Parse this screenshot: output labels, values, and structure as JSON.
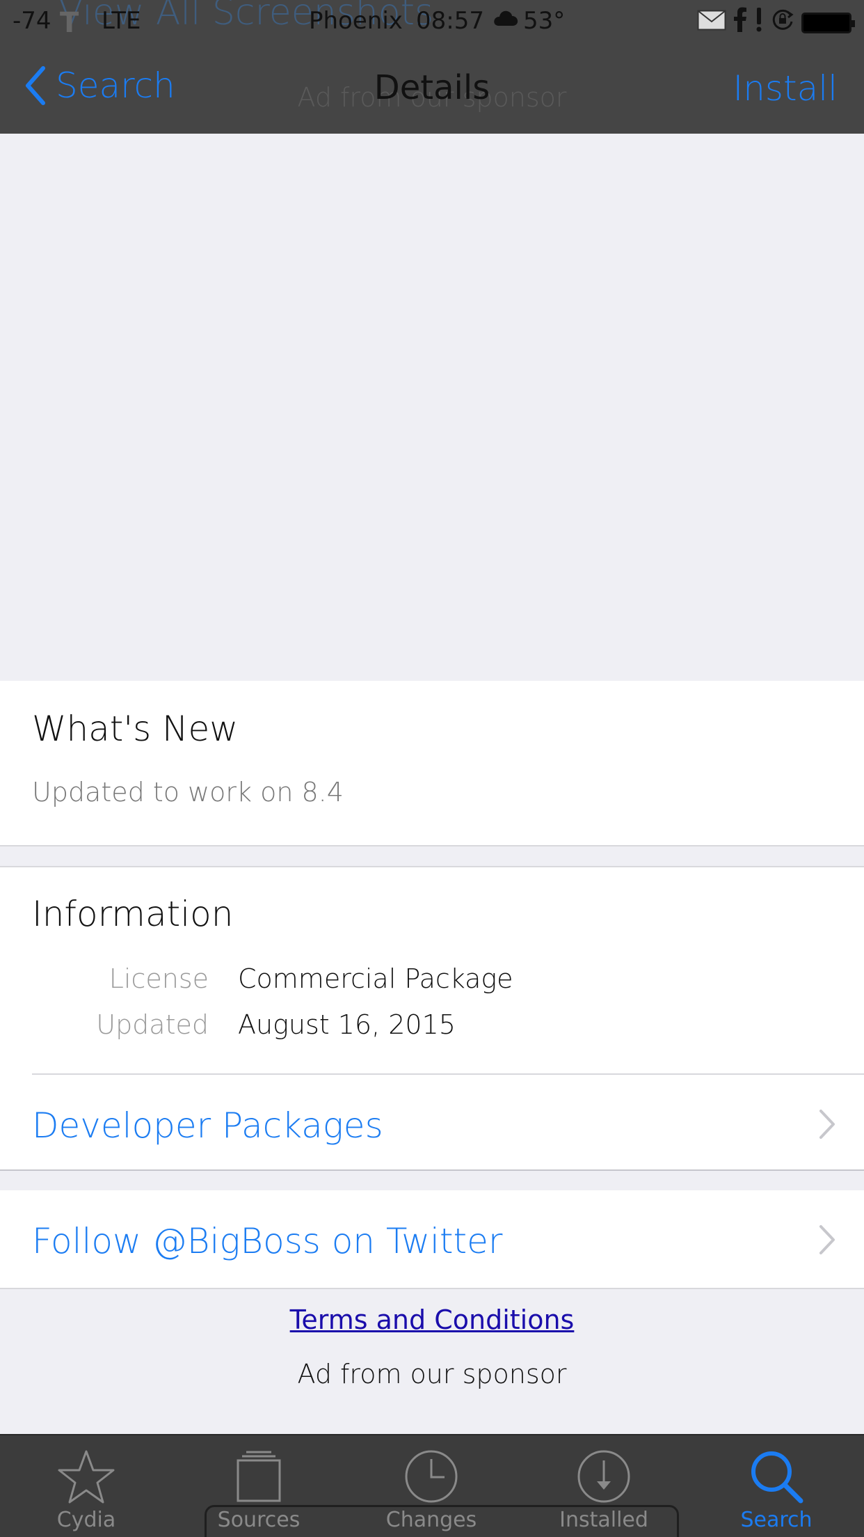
{
  "status_bar": {
    "signal": "-74",
    "carrier": "T",
    "network": "LTE",
    "city": "Phoenix",
    "time": "08:57",
    "weather_icon": "cloud-icon",
    "temperature": "53°"
  },
  "background": {
    "ghost_title": "View All Screenshots",
    "ghost_subtitle": "Ad from our sponsor"
  },
  "nav": {
    "back_label": "Search",
    "title": "Details",
    "install_label": "Install"
  },
  "whats_new": {
    "title": "What's New",
    "body": "Updated to work on 8.4"
  },
  "information": {
    "title": "Information",
    "rows": [
      {
        "key": "License",
        "value": "Commercial Package"
      },
      {
        "key": "Updated",
        "value": "August 16, 2015"
      }
    ],
    "developer_packages_label": "Developer Packages"
  },
  "twitter": {
    "label": "Follow @BigBoss on Twitter"
  },
  "footer": {
    "terms_label": "Terms and Conditions",
    "sponsor_label": "Ad from our sponsor"
  },
  "tabs": [
    {
      "label": "Cydia",
      "icon": "star-icon"
    },
    {
      "label": "Sources",
      "icon": "sources-icon"
    },
    {
      "label": "Changes",
      "icon": "clock-icon"
    },
    {
      "label": "Installed",
      "icon": "download-icon"
    },
    {
      "label": "Search",
      "icon": "search-icon",
      "active": true
    }
  ],
  "colors": {
    "accent": "#1b7cf2",
    "header_bg": "#454545",
    "tabbar_bg": "#3c3c3c",
    "page_bg": "#efeff4"
  }
}
